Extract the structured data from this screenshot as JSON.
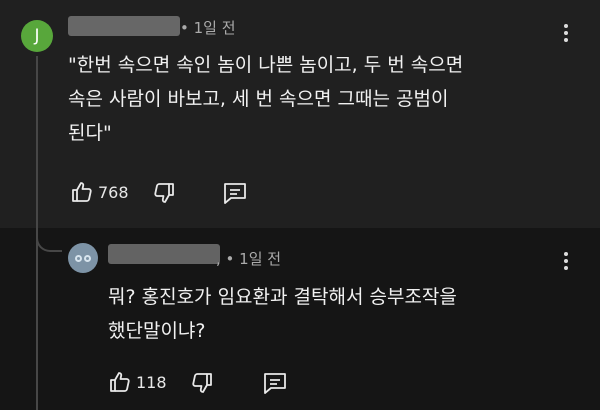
{
  "comments": [
    {
      "avatar_letter": "J",
      "time": "• 1일 전",
      "text": "\"한번 속으면 속인 놈이 나쁜 놈이고, 두 번 속으면\n속은 사람이 바보고, 세 번 속으면 그때는 공범이\n된다\"",
      "likes": "768"
    },
    {
      "time": ", • 1일 전",
      "text": "뭐? 홍진호가 임요환과 결탁해서 승부조작을\n했단말이냐?",
      "likes": "118"
    }
  ],
  "icons": [
    "thumb-up-icon",
    "thumb-down-icon",
    "reply-icon",
    "more-vert-icon",
    "avatar-icon"
  ],
  "colors": {
    "avatar_j": "#58a73b",
    "avatar_2": "#7d93a6",
    "top_bg": "#202020",
    "bottom_bg": "#151515"
  }
}
